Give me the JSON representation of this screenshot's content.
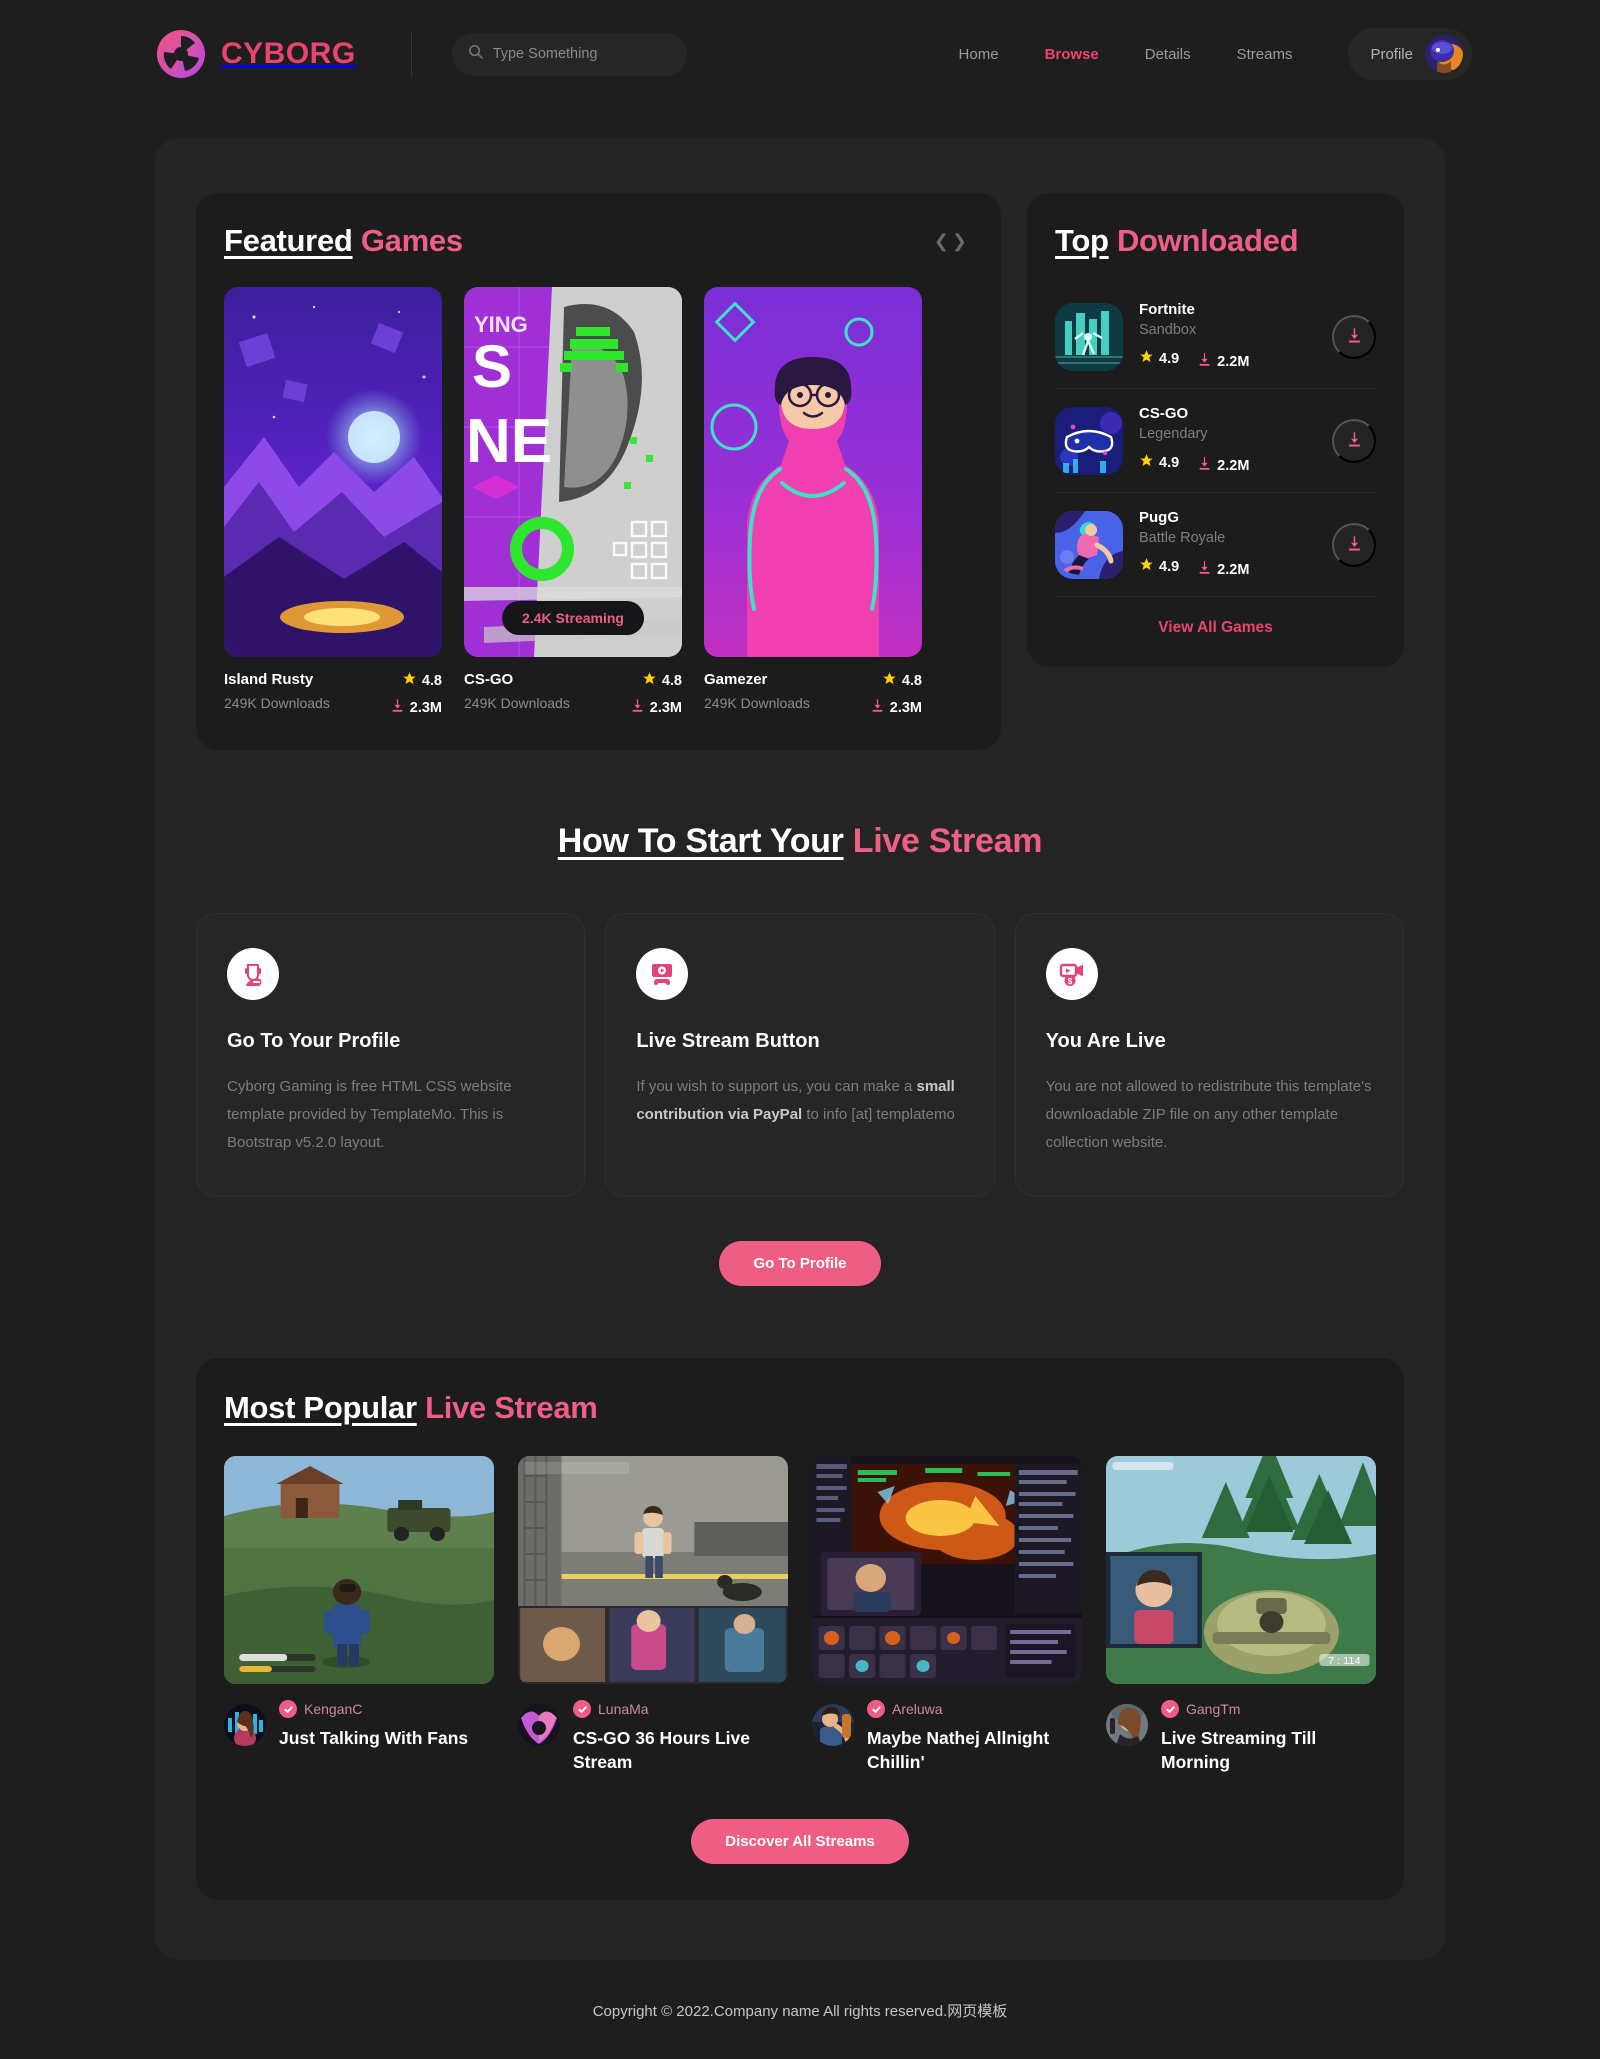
{
  "brand": {
    "name": "CYBORG",
    "logo_icon": "cyborg-aperture-logo",
    "color": "#e9456f"
  },
  "search": {
    "placeholder": "Type Something",
    "value": "",
    "icon": "search-icon"
  },
  "nav": {
    "items": [
      {
        "label": "Home",
        "active": false
      },
      {
        "label": "Browse",
        "active": true
      },
      {
        "label": "Details",
        "active": false
      },
      {
        "label": "Streams",
        "active": false
      }
    ],
    "profile_label": "Profile",
    "profile_avatar_icon": "user-avatar"
  },
  "featured": {
    "title_white": "Featured",
    "title_pink": "Games",
    "prev_icon": "chevron-left-icon",
    "next_icon": "chevron-right-icon",
    "cards": [
      {
        "name": "Island Rusty",
        "downloads": "249K Downloads",
        "rating": "4.8",
        "download_count": "2.3M",
        "badge": null,
        "art": "island-rusty-art"
      },
      {
        "name": "CS-GO",
        "downloads": "249K Downloads",
        "rating": "4.8",
        "download_count": "2.3M",
        "badge": "2.4K Streaming",
        "art": "csgo-art"
      },
      {
        "name": "Gamezer",
        "downloads": "249K Downloads",
        "rating": "4.8",
        "download_count": "2.3M",
        "badge": null,
        "art": "gamezer-art"
      }
    ]
  },
  "top_downloaded": {
    "title_white": "Top",
    "title_pink": "Downloaded",
    "view_all_label": "View All Games",
    "items": [
      {
        "name": "Fortnite",
        "genre": "Sandbox",
        "rating": "4.9",
        "downloads": "2.2M",
        "art": "fortnite-art",
        "download_icon": "download-icon"
      },
      {
        "name": "CS-GO",
        "genre": "Legendary",
        "rating": "4.9",
        "downloads": "2.2M",
        "art": "csgo-vr-art",
        "download_icon": "download-icon"
      },
      {
        "name": "PugG",
        "genre": "Battle Royale",
        "rating": "4.9",
        "downloads": "2.2M",
        "art": "pugg-art",
        "download_icon": "download-icon"
      }
    ]
  },
  "howto": {
    "title_white": "How To Start Your",
    "title_pink": "Live Stream",
    "cards": [
      {
        "icon": "gamer-headset-icon",
        "heading": "Go To Your Profile",
        "body_before": "Cyborg Gaming is free HTML CSS website template provided by TemplateMo. This is Bootstrap v5.2.0 layout.",
        "body_bold": "",
        "body_after": ""
      },
      {
        "icon": "stream-monitor-icon",
        "heading": "Live Stream Button",
        "body_before": "If you wish to support us, you can make a ",
        "body_bold": "small contribution via PayPal",
        "body_after": " to info [at] templatemo"
      },
      {
        "icon": "video-dollar-icon",
        "heading": "You Are Live",
        "body_before": "You are not allowed to redistribute this template's downloadable ZIP file on any other template collection website.",
        "body_bold": "",
        "body_after": ""
      }
    ],
    "button_label": "Go To Profile"
  },
  "popular": {
    "title_white": "Most Popular",
    "title_pink": "Live Stream",
    "button_label": "Discover All Streams",
    "streams": [
      {
        "username": "KenganC",
        "title": "Just Talking With Fans",
        "verified_icon": "verified-check-icon",
        "thumb": "pubg-gameplay",
        "avatar": "kenganc-avatar"
      },
      {
        "username": "LunaMa",
        "title": "CS-GO 36 Hours Live Stream",
        "verified_icon": "verified-check-icon",
        "thumb": "csgo-gameplay",
        "avatar": "lunama-avatar"
      },
      {
        "username": "Areluwa",
        "title": "Maybe Nathej Allnight Chillin'",
        "verified_icon": "verified-check-icon",
        "thumb": "mmo-gameplay",
        "avatar": "areluwa-avatar"
      },
      {
        "username": "GangTm",
        "title": "Live Streaming Till Morning",
        "verified_icon": "verified-check-icon",
        "thumb": "fortnite-gameplay",
        "avatar": "gangtm-avatar"
      }
    ]
  },
  "footer": {
    "copyright": "Copyright © 2022.Company name All rights reserved.网页模板"
  }
}
